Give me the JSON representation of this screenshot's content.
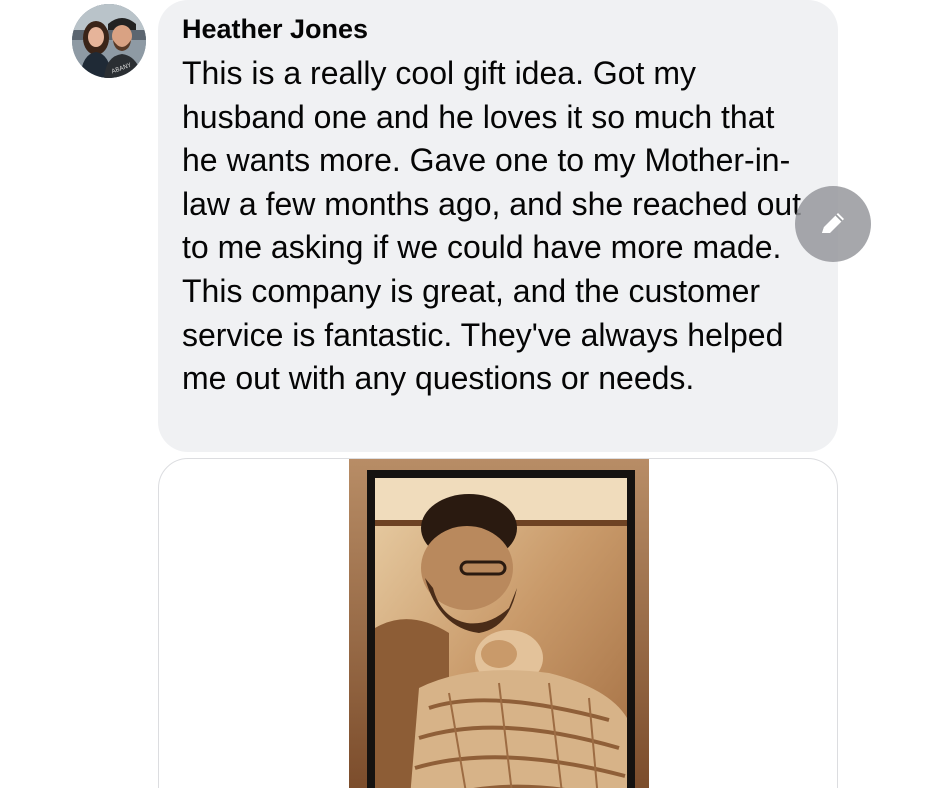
{
  "comment": {
    "author": "Heather Jones",
    "text": "This is a really cool gift idea. Got my husband one and he loves it so much that he wants more. Gave one to my Mother-in-law a few months ago, and she reached out to me asking if we could have more made. This company is great, and the customer service is fantastic. They've always helped me out with any questions or needs."
  },
  "icons": {
    "edit": "pencil-icon"
  },
  "colors": {
    "bubble_background": "#f0f1f3",
    "text": "#050505",
    "edit_button": "#96989c"
  }
}
